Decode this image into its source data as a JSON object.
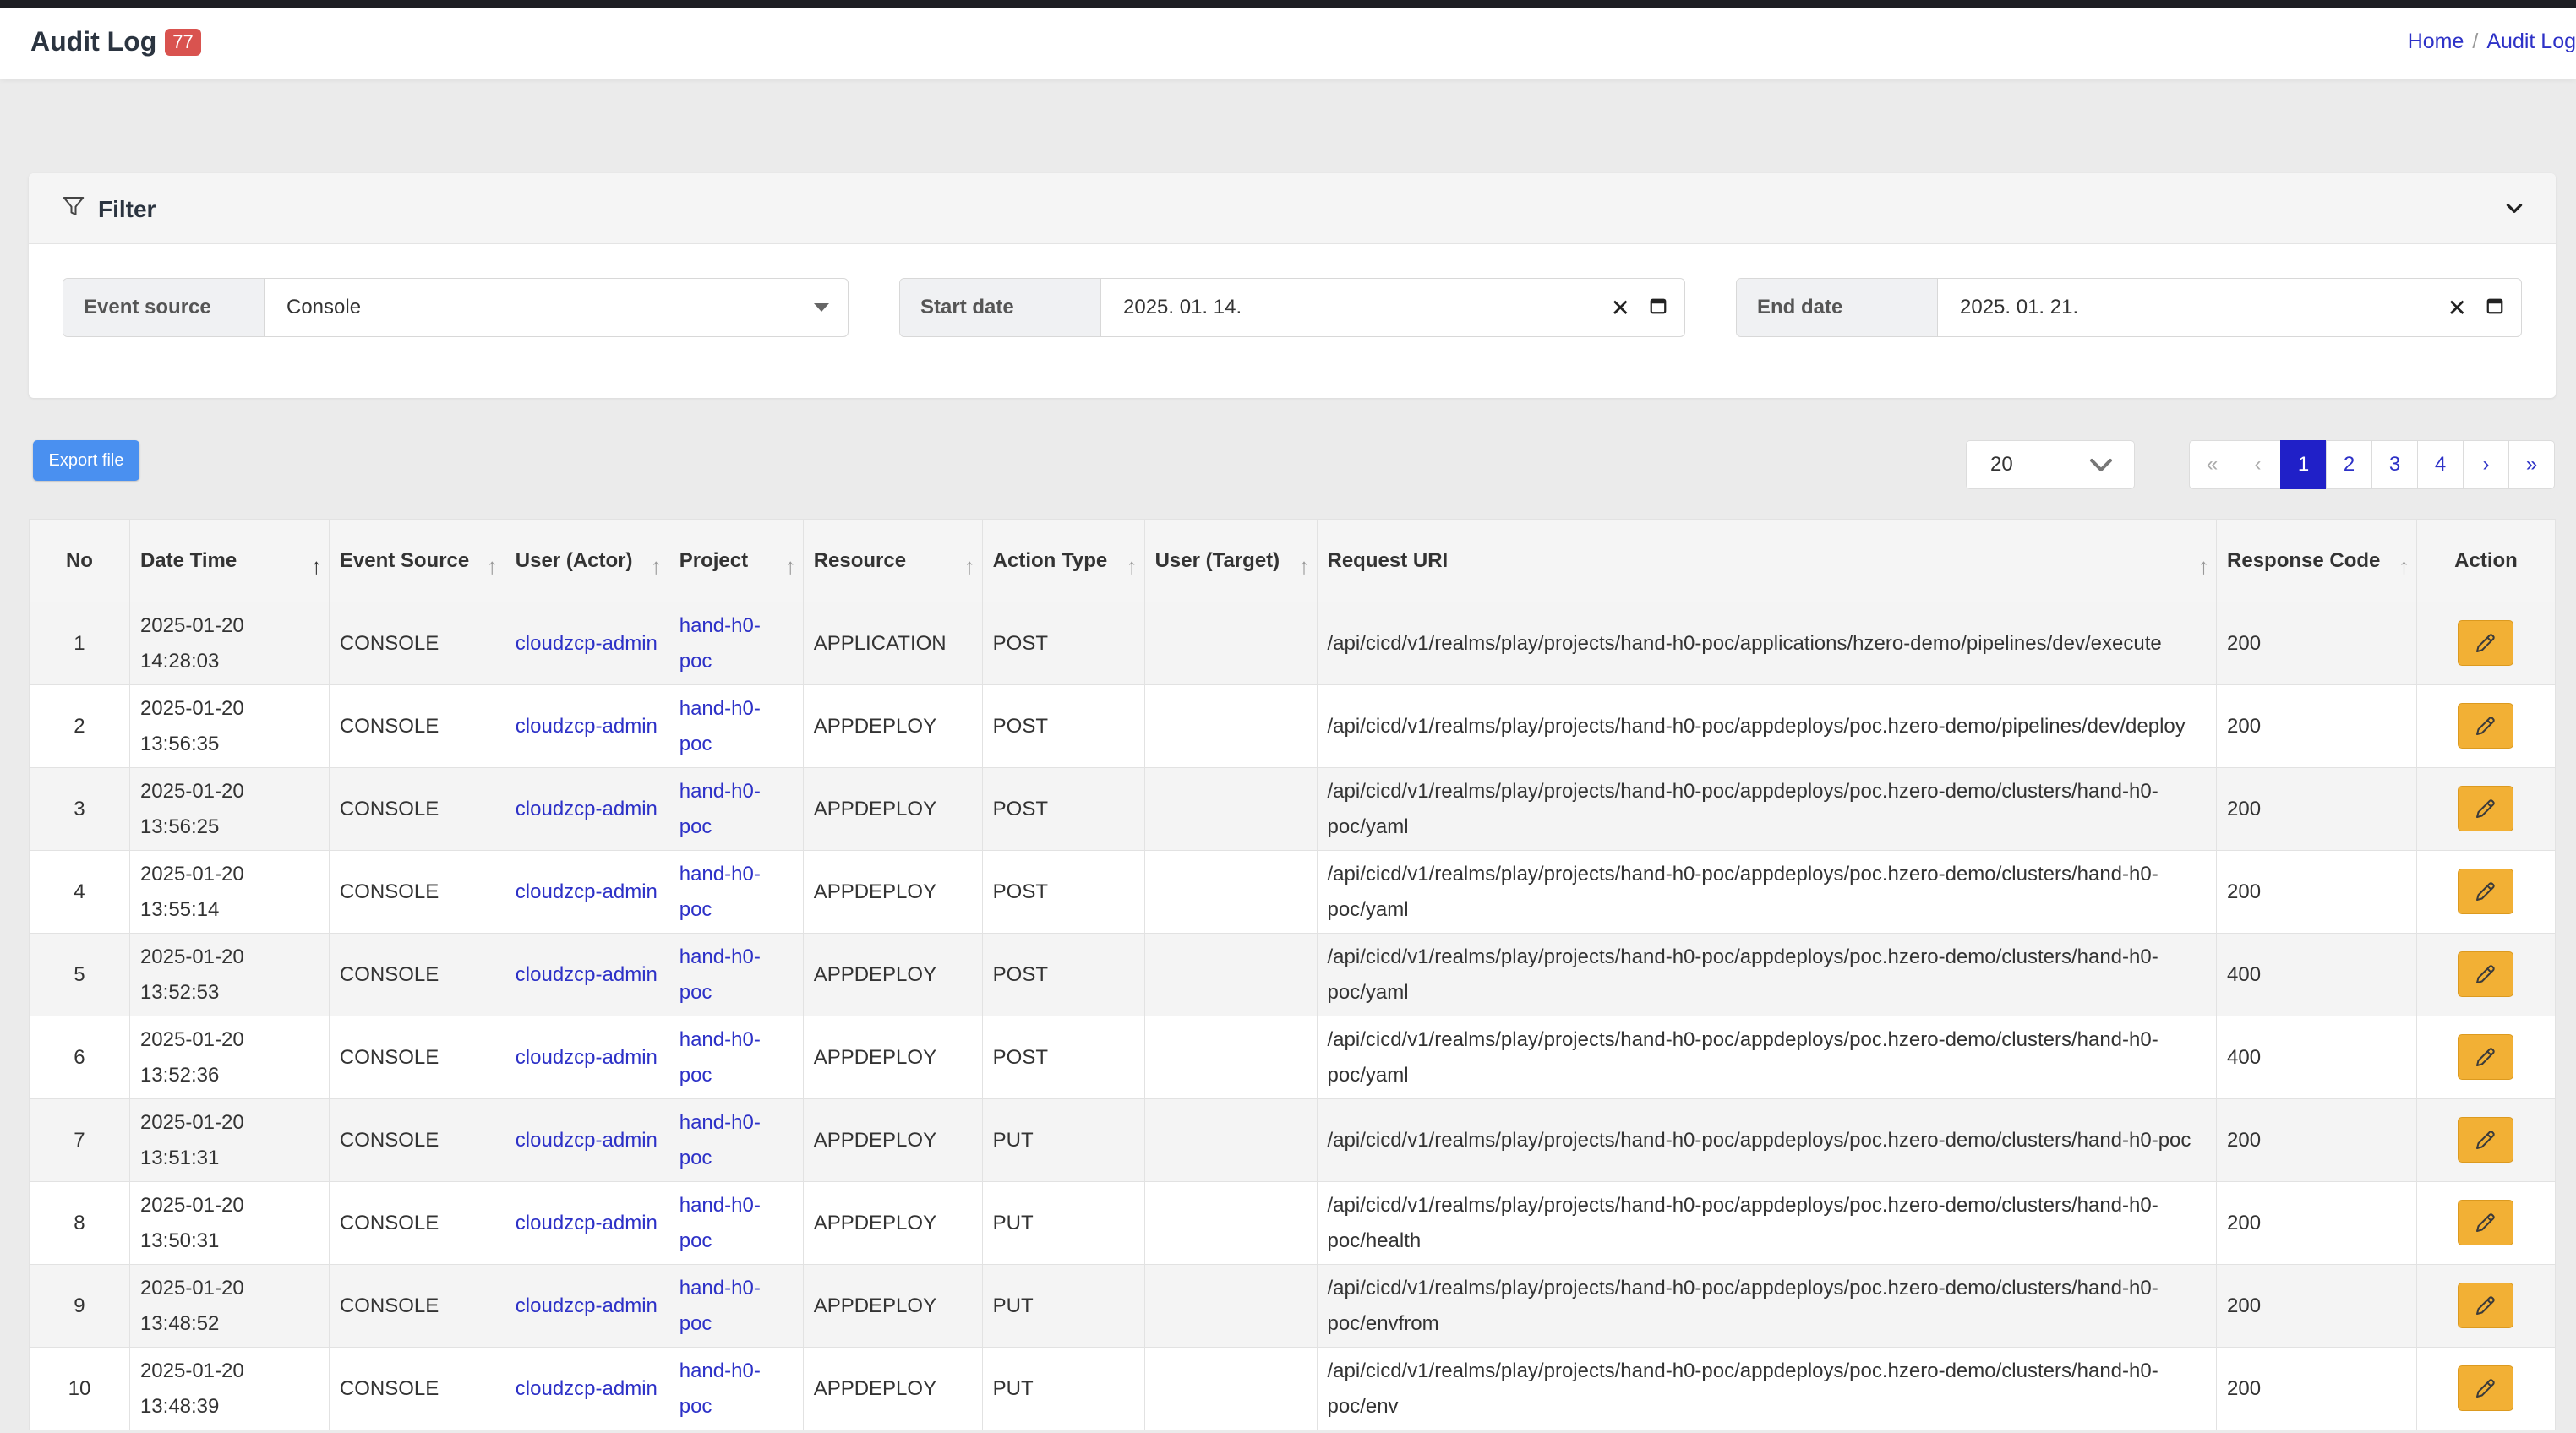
{
  "header": {
    "title": "Audit Log",
    "badge": "77",
    "breadcrumb": [
      "Home",
      "/",
      "Audit Log"
    ]
  },
  "filter": {
    "title": "Filter",
    "event_source": {
      "label": "Event source",
      "value": "Console"
    },
    "start_date": {
      "label": "Start date",
      "value": "2025. 01. 14."
    },
    "end_date": {
      "label": "End date",
      "value": "2025. 01. 21."
    }
  },
  "toolbar": {
    "export_label": "Export file",
    "page_size": "20",
    "pagination": [
      "«",
      "‹",
      "1",
      "2",
      "3",
      "4",
      "›",
      "»"
    ],
    "current_page": "1"
  },
  "table": {
    "headers": {
      "no": "No",
      "datetime": "Date Time",
      "event_source": "Event Source",
      "user_actor": "User (Actor)",
      "project": "Project",
      "resource": "Resource",
      "action_type": "Action Type",
      "user_target": "User (Target)",
      "request_uri": "Request URI",
      "response_code": "Response Code",
      "action": "Action"
    },
    "rows": [
      {
        "no": "1",
        "date": "2025-01-20",
        "time": "14:28:03",
        "source": "CONSOLE",
        "actor": "cloudzcp-admin",
        "project": "hand-h0-poc",
        "resource": "APPLICATION",
        "action": "POST",
        "target": "",
        "uri": "/api/cicd/v1/realms/play/projects/hand-h0-poc/applications/hzero-demo/pipelines/dev/execute",
        "code": "200"
      },
      {
        "no": "2",
        "date": "2025-01-20",
        "time": "13:56:35",
        "source": "CONSOLE",
        "actor": "cloudzcp-admin",
        "project": "hand-h0-poc",
        "resource": "APPDEPLOY",
        "action": "POST",
        "target": "",
        "uri": "/api/cicd/v1/realms/play/projects/hand-h0-poc/appdeploys/poc.hzero-demo/pipelines/dev/deploy",
        "code": "200"
      },
      {
        "no": "3",
        "date": "2025-01-20",
        "time": "13:56:25",
        "source": "CONSOLE",
        "actor": "cloudzcp-admin",
        "project": "hand-h0-poc",
        "resource": "APPDEPLOY",
        "action": "POST",
        "target": "",
        "uri": "/api/cicd/v1/realms/play/projects/hand-h0-poc/appdeploys/poc.hzero-demo/clusters/hand-h0-poc/yaml",
        "code": "200"
      },
      {
        "no": "4",
        "date": "2025-01-20",
        "time": "13:55:14",
        "source": "CONSOLE",
        "actor": "cloudzcp-admin",
        "project": "hand-h0-poc",
        "resource": "APPDEPLOY",
        "action": "POST",
        "target": "",
        "uri": "/api/cicd/v1/realms/play/projects/hand-h0-poc/appdeploys/poc.hzero-demo/clusters/hand-h0-poc/yaml",
        "code": "200"
      },
      {
        "no": "5",
        "date": "2025-01-20",
        "time": "13:52:53",
        "source": "CONSOLE",
        "actor": "cloudzcp-admin",
        "project": "hand-h0-poc",
        "resource": "APPDEPLOY",
        "action": "POST",
        "target": "",
        "uri": "/api/cicd/v1/realms/play/projects/hand-h0-poc/appdeploys/poc.hzero-demo/clusters/hand-h0-poc/yaml",
        "code": "400"
      },
      {
        "no": "6",
        "date": "2025-01-20",
        "time": "13:52:36",
        "source": "CONSOLE",
        "actor": "cloudzcp-admin",
        "project": "hand-h0-poc",
        "resource": "APPDEPLOY",
        "action": "POST",
        "target": "",
        "uri": "/api/cicd/v1/realms/play/projects/hand-h0-poc/appdeploys/poc.hzero-demo/clusters/hand-h0-poc/yaml",
        "code": "400"
      },
      {
        "no": "7",
        "date": "2025-01-20",
        "time": "13:51:31",
        "source": "CONSOLE",
        "actor": "cloudzcp-admin",
        "project": "hand-h0-poc",
        "resource": "APPDEPLOY",
        "action": "PUT",
        "target": "",
        "uri": "/api/cicd/v1/realms/play/projects/hand-h0-poc/appdeploys/poc.hzero-demo/clusters/hand-h0-poc",
        "code": "200"
      },
      {
        "no": "8",
        "date": "2025-01-20",
        "time": "13:50:31",
        "source": "CONSOLE",
        "actor": "cloudzcp-admin",
        "project": "hand-h0-poc",
        "resource": "APPDEPLOY",
        "action": "PUT",
        "target": "",
        "uri": "/api/cicd/v1/realms/play/projects/hand-h0-poc/appdeploys/poc.hzero-demo/clusters/hand-h0-poc/health",
        "code": "200"
      },
      {
        "no": "9",
        "date": "2025-01-20",
        "time": "13:48:52",
        "source": "CONSOLE",
        "actor": "cloudzcp-admin",
        "project": "hand-h0-poc",
        "resource": "APPDEPLOY",
        "action": "PUT",
        "target": "",
        "uri": "/api/cicd/v1/realms/play/projects/hand-h0-poc/appdeploys/poc.hzero-demo/clusters/hand-h0-poc/envfrom",
        "code": "200"
      },
      {
        "no": "10",
        "date": "2025-01-20",
        "time": "13:48:39",
        "source": "CONSOLE",
        "actor": "cloudzcp-admin",
        "project": "hand-h0-poc",
        "resource": "APPDEPLOY",
        "action": "PUT",
        "target": "",
        "uri": "/api/cicd/v1/realms/play/projects/hand-h0-poc/appdeploys/poc.hzero-demo/clusters/hand-h0-poc/env",
        "code": "200"
      }
    ]
  }
}
